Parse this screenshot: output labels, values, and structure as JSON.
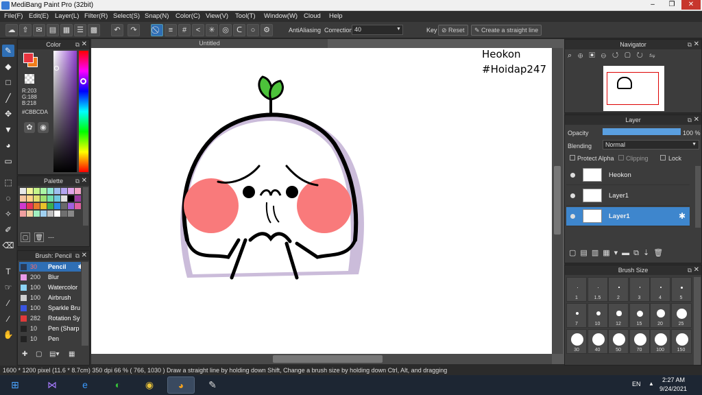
{
  "window": {
    "title": "MediBang Paint Pro (32bit)",
    "min": "–",
    "max": "❐",
    "close": "✕"
  },
  "menu": [
    "File(F)",
    "Edit(E)",
    "Layer(L)",
    "Filter(R)",
    "Select(S)",
    "Snap(N)",
    "Color(C)",
    "View(V)",
    "Tool(T)",
    "Window(W)",
    "Cloud",
    "Help"
  ],
  "toolbar": {
    "antialias_label": "AntiAliasing",
    "correction_label": "Correction",
    "correction_value": "40",
    "key_label": "Key",
    "reset_label": "Reset",
    "straight_line_label": "Create a straight line"
  },
  "color_panel": {
    "title": "Color",
    "r": "R:203",
    "g": "G:188",
    "b": "B:218",
    "hex": "#CBBCDA",
    "primary": "#e8343f",
    "secondary": "#f07d1a"
  },
  "palette": {
    "title": "Palette",
    "more": "---"
  },
  "brush_panel": {
    "title": "Brush: Pencil",
    "items": [
      {
        "size": "30",
        "name": "Pencil",
        "color": "#2a3a55",
        "selected": true
      },
      {
        "size": "200",
        "name": "Blur",
        "color": "#e89ae8"
      },
      {
        "size": "100",
        "name": "Watercolor",
        "color": "#8cd3f5"
      },
      {
        "size": "100",
        "name": "Airbrush",
        "color": "#cfcfcf"
      },
      {
        "size": "100",
        "name": "Sparkle Bru",
        "color": "#3a55e0"
      },
      {
        "size": "282",
        "name": "Rotation Sy",
        "color": "#e03a3a"
      },
      {
        "size": "10",
        "name": "Pen (Sharp",
        "color": "#222222"
      },
      {
        "size": "10",
        "name": "Pen",
        "color": "#222222"
      }
    ]
  },
  "document": {
    "tab": "Untitled",
    "text_line1": "Heokon",
    "text_line2": "#Hoidap247"
  },
  "navigator": {
    "title": "Navigator"
  },
  "layer_panel": {
    "title": "Layer",
    "opacity_label": "Opacity",
    "opacity_value": "100 %",
    "opacity": 1.0,
    "blending_label": "Blending",
    "blending_value": "Normal",
    "protect_alpha": "Protect Alpha",
    "clipping": "Clipping",
    "lock": "Lock",
    "layers": [
      {
        "name": "Heokon",
        "selected": false
      },
      {
        "name": "Layer1",
        "selected": false
      },
      {
        "name": "Layer1",
        "selected": true
      }
    ]
  },
  "brush_size": {
    "title": "Brush Size",
    "sizes": [
      "1",
      "1.5",
      "2",
      "3",
      "4",
      "5",
      "7",
      "10",
      "12",
      "15",
      "20",
      "25",
      "30",
      "40",
      "50",
      "70",
      "100",
      "150"
    ]
  },
  "status": "1600 * 1200 pixel  (11.6 * 8.7cm)  350 dpi  66 %  ( 766, 1030 )  Draw a straight line by holding down Shift, Change a brush size by holding down Ctrl, Alt, and dragging",
  "taskbar": {
    "lang": "EN",
    "time": "2:27 AM",
    "date": "9/24/2021"
  }
}
